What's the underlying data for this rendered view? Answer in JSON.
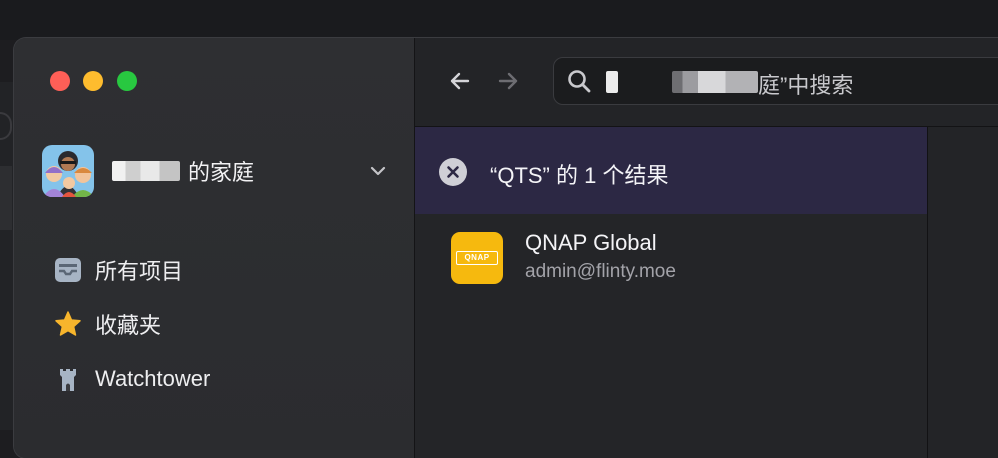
{
  "search": {
    "text": "庭”中搜索"
  },
  "account": {
    "name": "的家庭"
  },
  "sidebar": {
    "items": [
      {
        "label": "所有项目",
        "icon": "all-items-icon"
      },
      {
        "label": "收藏夹",
        "icon": "star-icon"
      },
      {
        "label": "Watchtower",
        "icon": "watchtower-icon"
      }
    ]
  },
  "results": {
    "header": "“QTS” 的 1 个结果",
    "items": [
      {
        "title": "QNAP Global",
        "subtitle": "admin@flinty.moe",
        "logo_text": "QNAP"
      }
    ]
  },
  "colors": {
    "close": "#fe5f57",
    "minimize": "#febc2e",
    "maximize": "#28c840",
    "results_header_bg": "#2c2844",
    "favorites_star": "#f7b52c",
    "item_icon_bg": "#f6b90e"
  }
}
